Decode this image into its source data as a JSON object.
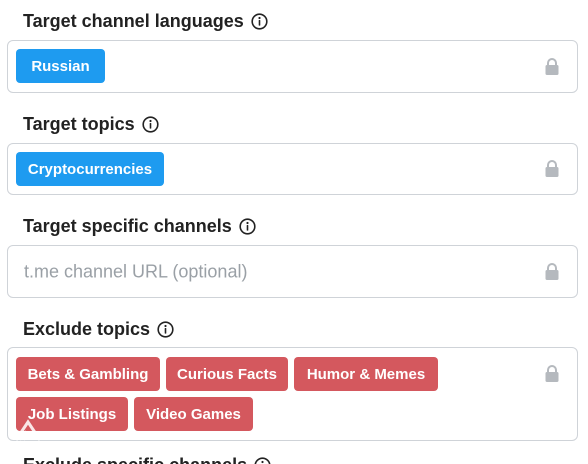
{
  "sections": [
    {
      "label": "Target channel languages",
      "chips": [
        "Russian"
      ]
    },
    {
      "label": "Target topics",
      "chips": [
        "Cryptocurrencies"
      ]
    },
    {
      "label": "Target specific channels",
      "input_placeholder": "t.me channel URL (optional)"
    },
    {
      "label": "Exclude topics",
      "chips": [
        "Bets & Gambling",
        "Curious Facts",
        "Humor & Memes",
        "Job Listings",
        "Video Games"
      ]
    },
    {
      "label": "Exclude specific channels"
    }
  ],
  "colors": {
    "chip_blue": "#1e9bf0",
    "chip_red": "#d4585e",
    "border": "#cfd3d8",
    "placeholder": "#9aa0a6"
  },
  "icons": {
    "info": "info-icon",
    "lock": "lock-icon"
  }
}
